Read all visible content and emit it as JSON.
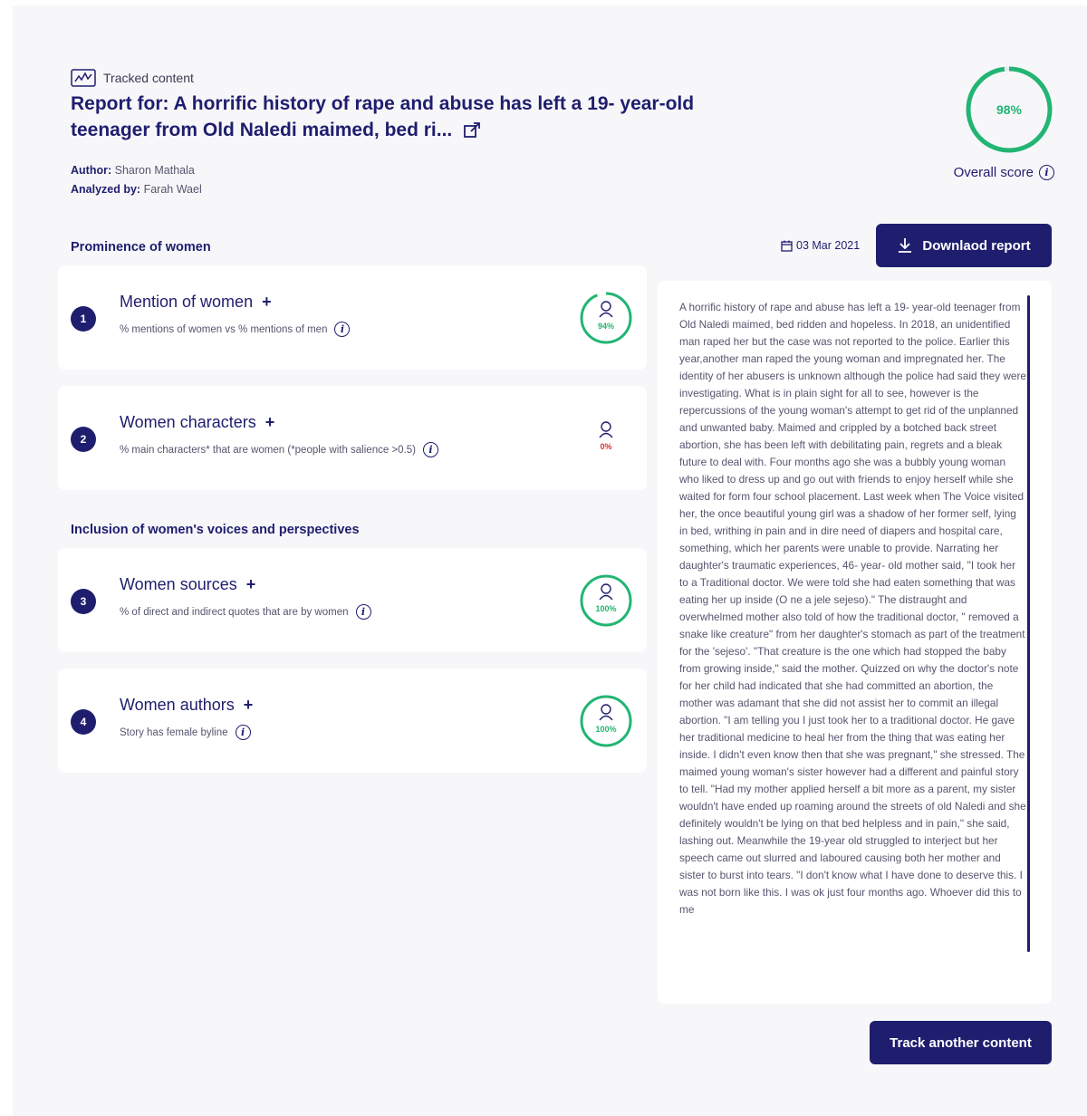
{
  "header": {
    "tracked_label": "Tracked content",
    "title": "Report for: A horrific history of rape and abuse has left a 19- year-old teenager from Old Naledi maimed, bed ri...",
    "author_label": "Author:",
    "author": "Sharon Mathala",
    "analyzed_label": "Analyzed by:",
    "analyzed_by": "Farah Wael"
  },
  "score": {
    "value_text": "98%",
    "value": 0.98,
    "label": "Overall score"
  },
  "sections": {
    "prominence": "Prominence of women",
    "inclusion": "Inclusion of women's voices and perspectives"
  },
  "metrics": [
    {
      "number": "1",
      "title": "Mention of women",
      "subtitle": "% mentions of women vs % mentions of men",
      "pct_text": "94%",
      "pct": 0.94,
      "color": "#22b573"
    },
    {
      "number": "2",
      "title": "Women characters",
      "subtitle": "% main characters* that are women (*people with salience >0.5)",
      "pct_text": "0%",
      "pct": 0,
      "color": "#e0302b"
    },
    {
      "number": "3",
      "title": "Women sources",
      "subtitle": "% of direct and indirect quotes that are by women",
      "pct_text": "100%",
      "pct": 1.0,
      "color": "#22b573"
    },
    {
      "number": "4",
      "title": "Women authors",
      "subtitle": "Story has female byline",
      "pct_text": "100%",
      "pct": 1.0,
      "color": "#22b573"
    }
  ],
  "actions": {
    "date": "03 Mar 2021",
    "download": "Downlaod report",
    "track_another": "Track another content"
  },
  "article": {
    "text": "A horrific history of rape and abuse has left a 19- year-old teenager from Old Naledi maimed, bed ridden and hopeless. In 2018, an unidentified man raped her but the case was not reported to the police. Earlier this year,another man raped the young woman and impregnated her. The identity of her abusers is unknown although the police had said they were investigating. What is in plain sight for all to see, however is the repercussions of the young woman's attempt to get rid of the unplanned and unwanted baby. Maimed and crippled by a botched back street abortion, she has been left with debilitating pain, regrets and a bleak future to deal with. Four months ago she was a bubbly young woman who liked to dress up and go out with friends to enjoy herself while she waited for form four school placement. Last week when The Voice visited her, the once beautiful young girl was a shadow of her former self, lying in bed, writhing in pain and in dire need of diapers and hospital care, something, which her parents were unable to provide. Narrating her daughter's traumatic experiences, 46- year- old mother said, \"I took her to a Traditional doctor. We were told she had eaten something that was eating her up inside (O ne a jele sejeso).\" The distraught and overwhelmed mother also told of how the traditional doctor, \" removed a snake like creature\" from her daughter's stomach as part of the treatment for the 'sejeso'. \"That creature is the one which had stopped the baby from growing inside,\" said the mother. Quizzed on why the doctor's note for her child had indicated that she had committed an abortion, the mother was adamant that she did not assist her to commit an illegal abortion. \"I am telling you I just took her to a traditional doctor. He gave her traditional medicine to heal her from the thing that was eating her inside. I didn't even know then that she was pregnant,\" she stressed. The maimed young woman's sister however had a different and painful story to tell. \"Had my mother applied herself a bit more as a parent, my sister wouldn't have ended up roaming around the streets of old Naledi and she definitely wouldn't be lying on that bed helpless and in pain,\" she said, lashing out. Meanwhile the 19-year old struggled to interject but her speech came out slurred and laboured causing both her mother and sister to burst into tears. \"I don't know what I have done to deserve this. I was not born like this. I was ok just four months ago. Whoever did this to me"
  }
}
